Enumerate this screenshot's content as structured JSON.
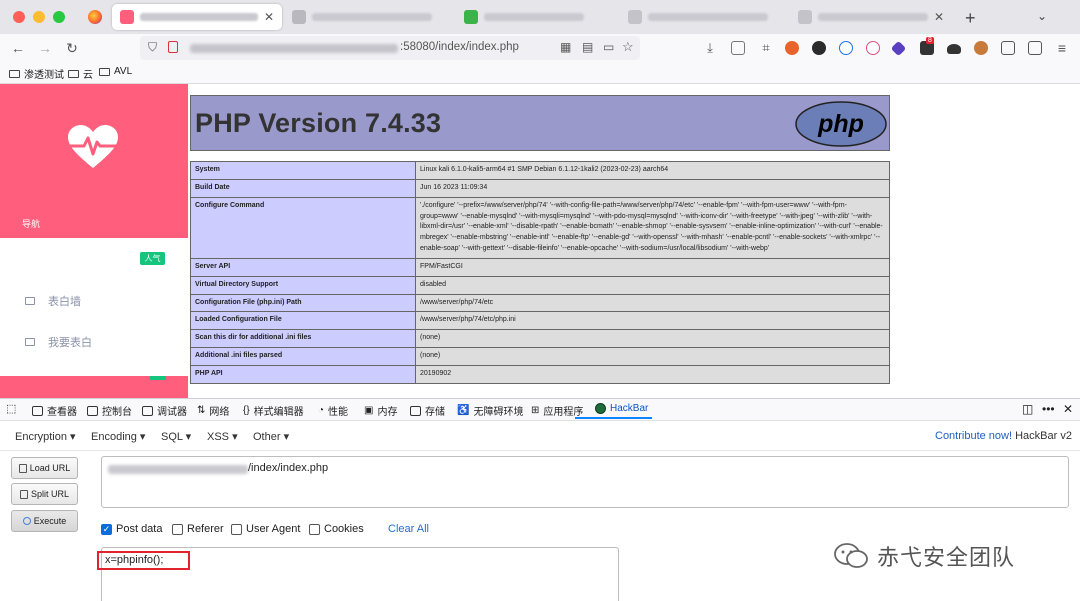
{
  "browser": {
    "url_visible": ":58080/index/index.php",
    "bookmarks": [
      "渗透测试",
      "云",
      "AVL"
    ],
    "extension_badge": "8"
  },
  "page": {
    "sidebar": {
      "nav_label": "导航",
      "hot_badge": "人气",
      "items": [
        "表白墙",
        "我要表白"
      ]
    },
    "php_title": "PHP Version 7.4.33",
    "php_logo_text": "php",
    "php_info": [
      {
        "key": "System",
        "value": "Linux kali 6.1.0-kali5-arm64 #1 SMP Debian 6.1.12-1kali2 (2023-02-23) aarch64"
      },
      {
        "key": "Build Date",
        "value": "Jun 16 2023 11:09:34"
      },
      {
        "key": "Configure Command",
        "value": "'./configure' '--prefix=/www/server/php/74' '--with-config-file-path=/www/server/php/74/etc' '--enable-fpm' '--with-fpm-user=www' '--with-fpm-group=www' '--enable-mysqlnd' '--with-mysqli=mysqlnd' '--with-pdo-mysql=mysqlnd' '--with-iconv-dir' '--with-freetype' '--with-jpeg' '--with-zlib' '--with-libxml-dir=/usr' '--enable-xml' '--disable-rpath' '--enable-bcmath' '--enable-shmop' '--enable-sysvsem' '--enable-inline-optimization' '--with-curl' '--enable-mbregex' '--enable-mbstring' '--enable-intl' '--enable-ftp' '--enable-gd' '--with-openssl' '--with-mhash' '--enable-pcntl' '--enable-sockets' '--with-xmlrpc' '--enable-soap' '--with-gettext' '--disable-fileinfo' '--enable-opcache' '--with-sodium=/usr/local/libsodium' '--with-webp'"
      },
      {
        "key": "Server API",
        "value": "FPM/FastCGI"
      },
      {
        "key": "Virtual Directory Support",
        "value": "disabled"
      },
      {
        "key": "Configuration File (php.ini) Path",
        "value": "/www/server/php/74/etc"
      },
      {
        "key": "Loaded Configuration File",
        "value": "/www/server/php/74/etc/php.ini"
      },
      {
        "key": "Scan this dir for additional .ini files",
        "value": "(none)"
      },
      {
        "key": "Additional .ini files parsed",
        "value": "(none)"
      },
      {
        "key": "PHP API",
        "value": "20190902"
      }
    ]
  },
  "devtools": {
    "tabs": [
      "查看器",
      "控制台",
      "调试器",
      "网络",
      "样式编辑器",
      "性能",
      "内存",
      "存储",
      "无障碍环境",
      "应用程序",
      "HackBar"
    ],
    "hackbar": {
      "menu": [
        "Encryption",
        "Encoding",
        "SQL",
        "XSS",
        "Other"
      ],
      "contribute_link": "Contribute now!",
      "contribute_suffix": " HackBar v2",
      "buttons": {
        "load": "Load URL",
        "split": "Split URL",
        "execute": "Execute"
      },
      "url_value": "/index/index.php",
      "options": {
        "post": "Post data",
        "referer": "Referer",
        "user_agent": "User Agent",
        "cookies": "Cookies"
      },
      "clear_all": "Clear All",
      "post_value": "x=phpinfo();"
    }
  },
  "watermark": "赤弋安全团队",
  "colors": {
    "accent_pink": "#ff5e7d",
    "php_purple": "#9999cc",
    "link_blue": "#1f6fd1"
  }
}
